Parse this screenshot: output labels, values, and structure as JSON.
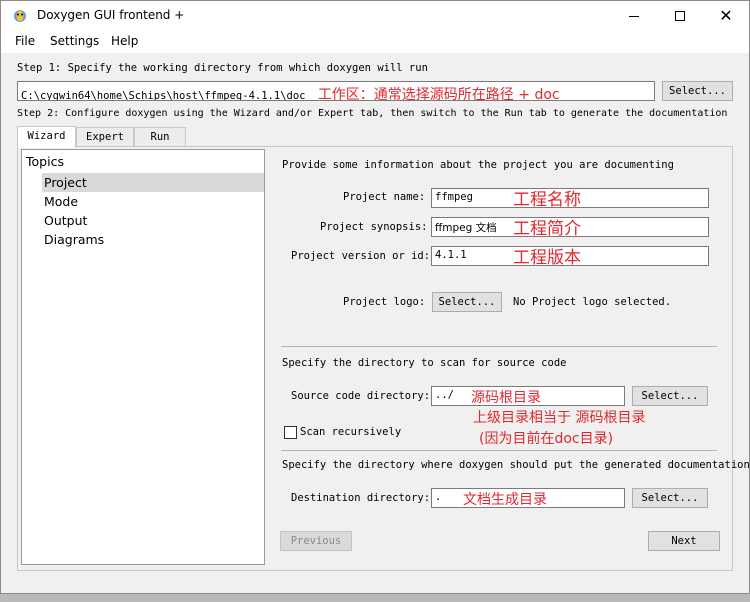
{
  "window": {
    "title": "Doxygen GUI frontend +"
  },
  "menu": [
    "File",
    "Settings",
    "Help"
  ],
  "step1": {
    "label": "Step 1: Specify the working directory from which doxygen will run",
    "workdir_value": "C:\\cygwin64\\home\\Schips\\host\\ffmpeg-4.1.1\\doc",
    "workdir_annotation": "工作区：通常选择源码所在路径 + doc",
    "select_label": "Select..."
  },
  "step2": {
    "label": "Step 2: Configure doxygen using the Wizard and/or Expert tab, then switch to the Run tab to generate the documentation"
  },
  "tabs": [
    "Wizard",
    "Expert",
    "Run"
  ],
  "topics": {
    "title": "Topics",
    "items": [
      "Project",
      "Mode",
      "Output",
      "Diagrams"
    ]
  },
  "project": {
    "intro": "Provide some information about the project you are documenting",
    "name_label": "Project name:",
    "name_value": "ffmpeg",
    "name_annotation": "工程名称",
    "synopsis_label": "Project synopsis:",
    "synopsis_value": "ffmpeg 文档",
    "synopsis_annotation": "工程简介",
    "version_label": "Project version or id:",
    "version_value": "4.1.1",
    "version_annotation": "工程版本",
    "logo_label": "Project logo:",
    "logo_button": "Select...",
    "logo_status": "No Project logo selected."
  },
  "source": {
    "intro": "Specify the directory to scan for source code",
    "dir_label": "Source code directory:",
    "dir_value": "../",
    "dir_annotation": "源码根目录",
    "select_label": "Select...",
    "note_line1": "上级目录相当于 源码根目录",
    "note_line2": "(因为目前在doc目录)",
    "scan_label": "Scan recursively",
    "scan_checked": false
  },
  "destination": {
    "intro": "Specify the directory where doxygen should put the generated documentation",
    "dir_label": "Destination directory:",
    "dir_value": ".",
    "dir_annotation": "文档生成目录",
    "select_label": "Select..."
  },
  "nav": {
    "previous_label": "Previous",
    "next_label": "Next"
  },
  "colors": {
    "annotation": "#e0282e",
    "selected_topic": "#d9d9d9"
  }
}
